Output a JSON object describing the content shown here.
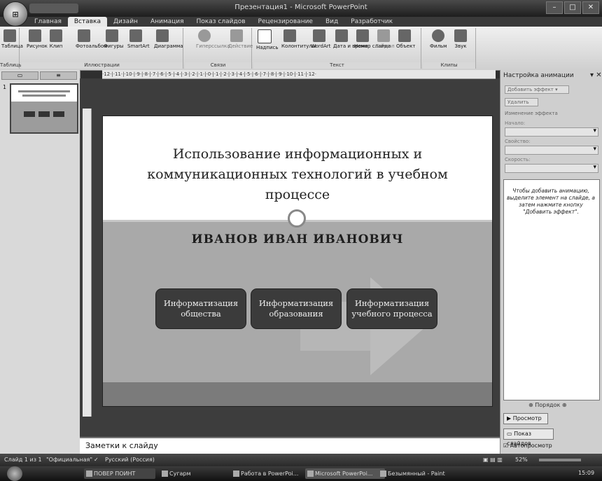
{
  "window": {
    "title": "Презентация1 - Microsoft PowerPoint",
    "office_button": "⊞"
  },
  "tabs": [
    "Главная",
    "Вставка",
    "Дизайн",
    "Анимация",
    "Показ слайдов",
    "Рецензирование",
    "Вид",
    "Разработчик"
  ],
  "active_tab": "Вставка",
  "ribbon": {
    "groups": [
      {
        "label": "Таблицы",
        "buttons": [
          "Таблица"
        ]
      },
      {
        "label": "Иллюстрации",
        "buttons": [
          "Рисунок",
          "Клип",
          "Фотоальбом",
          "Фигуры",
          "SmartArt",
          "Диаграмма"
        ]
      },
      {
        "label": "Связи",
        "buttons": [
          "Гиперссылка",
          "Действие"
        ]
      },
      {
        "label": "Текст",
        "buttons": [
          "Надпись",
          "Колонтитулы",
          "WordArt",
          "Дата и время",
          "Номер слайда",
          "Символ",
          "Объект"
        ]
      },
      {
        "label": "Клипы мультимедиа",
        "buttons": [
          "Фильм",
          "Звук"
        ]
      }
    ]
  },
  "ruler_text": "·12·|·11·|·10·|·9·|·8·|·7·|·6·|·5·|·4·|·3·|·2·|·1·|·0·|·1·|·2·|·3·|·4·|·5·|·6·|·7·|·8·|·9·|·10·|·11·|·12·",
  "slides_panel": {
    "thumbnail_number": "1"
  },
  "slide": {
    "title": "Использование информационных и коммуникационных технологий в учебном процессе",
    "subtitle": "ИВАНОВ ИВАН ИВАНОВИЧ",
    "boxes": [
      "Информатизация общества",
      "Информатизация образования",
      "Информатизация учебного процесса"
    ]
  },
  "notes": {
    "placeholder": "Заметки к слайду"
  },
  "animation_pane": {
    "title": "Настройка анимации",
    "add_effect": "Добавить эффект ▾",
    "remove": "Удалить",
    "change_label": "Изменение эффекта",
    "start_label": "Начало:",
    "property_label": "Свойство:",
    "speed_label": "Скорость:",
    "info": "Чтобы добавить анимацию, выделите элемент на слайде, а затем нажмите кнопку \"Добавить эффект\".",
    "reorder": "Порядок",
    "preview_button": "Просмотр",
    "slideshow_button": "Показ слайдов",
    "autopreview": "Автопросмотр"
  },
  "status_bar": {
    "slide_info": "Слайд 1 из 1",
    "theme": "\"Официальная\"",
    "language": "Русский (Россия)",
    "zoom": "52%"
  },
  "taskbar": {
    "items": [
      "ПОВЕР ПОИНТ",
      "Сугарм",
      "Работа в PowerPoi...",
      "Microsoft PowerPoi...",
      "Безымянный - Paint"
    ],
    "clock": "15:09"
  },
  "colors": {
    "slide_band": "#a9a9a9",
    "box_fill": "#3b3b3b",
    "ribbon": "#e5e5e5",
    "chrome": "#2f2f2f"
  }
}
